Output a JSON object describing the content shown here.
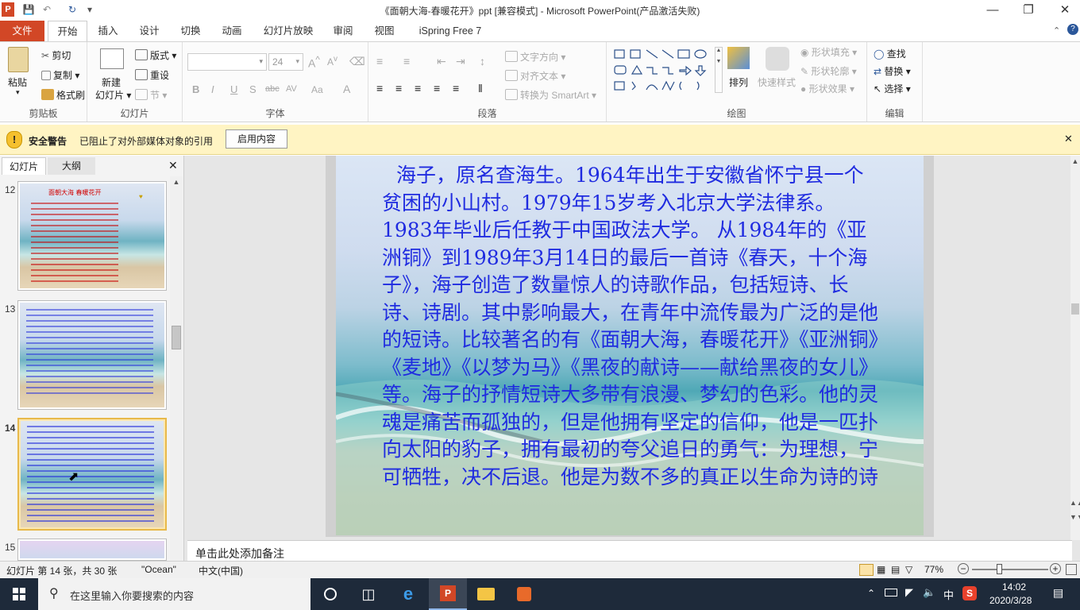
{
  "app": {
    "title": "《面朝大海-春暖花开》ppt [兼容模式] - Microsoft PowerPoint(产品激活失败)",
    "icon_letter": "P"
  },
  "colors": {
    "file_tab": "#d24726",
    "slide_text": "#1f2be0",
    "security_bar": "#fff4c3",
    "taskbar": "#1e2a3a",
    "accent": "#2b579a"
  },
  "tabs": [
    "文件",
    "开始",
    "插入",
    "设计",
    "切换",
    "动画",
    "幻灯片放映",
    "审阅",
    "视图",
    "iSpring Free 7"
  ],
  "active_tab": "开始",
  "ribbon": {
    "clipboard": {
      "label": "剪贴板",
      "paste": "粘贴",
      "cut": "剪切",
      "copy": "复制",
      "format_painter": "格式刷"
    },
    "slides": {
      "label": "幻灯片",
      "new_slide_1": "新建",
      "new_slide_2": "幻灯片",
      "layout": "版式",
      "reset": "重设",
      "section": "节"
    },
    "font": {
      "label": "字体",
      "size": "24",
      "buttons": [
        "B",
        "I",
        "U",
        "S",
        "abc",
        "AV",
        "Aa",
        "A"
      ]
    },
    "paragraph": {
      "label": "段落",
      "text_direction": "文字方向",
      "align_text": "对齐文本",
      "smartart": "转换为 SmartArt"
    },
    "drawing": {
      "label": "绘图",
      "arrange": "排列",
      "quick_styles": "快速样式",
      "shape_fill": "形状填充",
      "shape_outline": "形状轮廓",
      "shape_effects": "形状效果"
    },
    "editing": {
      "label": "编辑",
      "find": "查找",
      "replace": "替换",
      "select": "选择"
    }
  },
  "security": {
    "title": "安全警告",
    "message": "已阻止了对外部媒体对象的引用",
    "button": "启用内容"
  },
  "pane_tabs": [
    "幻灯片",
    "大纲"
  ],
  "thumbnails": [
    {
      "num": "12",
      "text": "面朝大海  春暖花开"
    },
    {
      "num": "13",
      "text": ""
    },
    {
      "num": "14",
      "text": ""
    },
    {
      "num": "15",
      "text": ""
    }
  ],
  "slide_text": "海子，原名查海生。1964年出生于安徽省怀宁县一个贫困的小山村。1979年15岁考入北京大学法律系。1983年毕业后任教于中国政法大学。 从1984年的《亚洲铜》到1989年3月14日的最后一首诗《春天，十个海子》，海子创造了数量惊人的诗歌作品，包括短诗、长诗、诗剧。其中影响最大，在青年中流传最为广泛的是他的短诗。比较著名的有《面朝大海，春暖花开》《亚洲铜》《麦地》《以梦为马》《黑夜的献诗——献给黑夜的女儿》等。海子的抒情短诗大多带有浪漫、梦幻的色彩。他的灵魂是痛苦而孤独的，但是他拥有坚定的信仰，他是一匹扑向太阳的豹子，拥有最初的夸父追日的勇气：为理想，宁可牺牲，决不后退。他是为数不多的真正以生命为诗的诗",
  "notes_placeholder": "单击此处添加备注",
  "status": {
    "slide_info": "幻灯片 第 14 张，共 30 张",
    "theme": "\"Ocean\"",
    "language": "中文(中国)",
    "zoom": "77%"
  },
  "taskbar": {
    "search_placeholder": "在这里输入你要搜索的内容",
    "time": "14:02",
    "date": "2020/3/28",
    "ime": "中"
  }
}
